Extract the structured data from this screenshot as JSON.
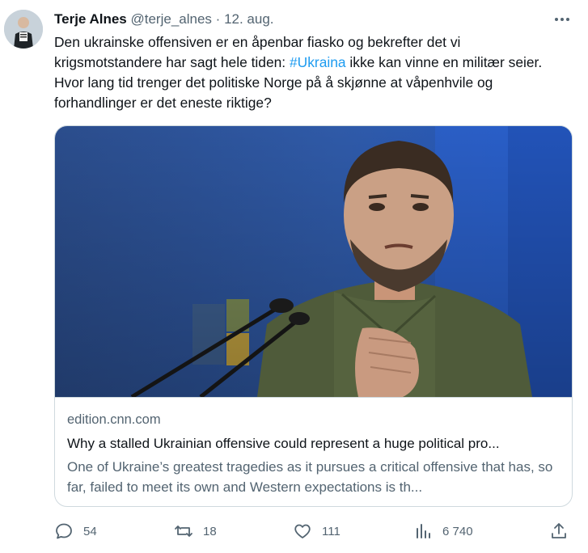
{
  "tweet": {
    "author_name": "Terje Alnes",
    "handle": "@terje_alnes",
    "separator": "·",
    "date": "12. aug.",
    "text_part1": "Den ukrainske offensiven er en åpenbar fiasko og bekrefter det vi krigsmotstandere har sagt hele tiden: ",
    "hashtag": "#Ukraina",
    "text_part2": " ikke kan vinne en militær seier. Hvor lang tid trenger det politiske Norge på å skjønne at våpenhvile og forhandlinger er det eneste riktige?"
  },
  "card": {
    "domain": "edition.cnn.com",
    "title": "Why a stalled Ukrainian offensive could represent a huge political pro...",
    "description": "One of Ukraine’s greatest tragedies as it pursues a critical offensive that has, so far, failed to meet its own and Western expectations is th..."
  },
  "actions": {
    "replies": "54",
    "retweets": "18",
    "likes": "111",
    "views": "6 740"
  },
  "icons": {
    "more": "more-icon",
    "reply": "reply-icon",
    "retweet": "retweet-icon",
    "like": "like-icon",
    "views": "views-icon",
    "share": "share-icon"
  },
  "colors": {
    "link": "#1d9bf0",
    "muted": "#536471",
    "text": "#0f1419"
  }
}
